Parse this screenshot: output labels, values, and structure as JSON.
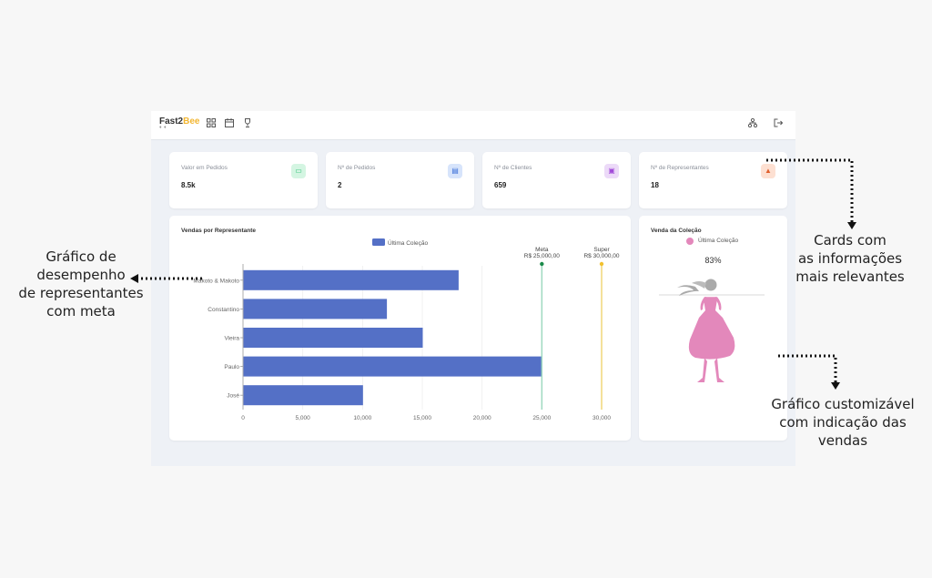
{
  "app": {
    "logo_main": "Fast2",
    "logo_accent": "Bee",
    "logo_tag": "♦ ♦"
  },
  "nav_icons": [
    "dashboard-icon",
    "calendar-icon",
    "trophy-icon"
  ],
  "header_right_icons": [
    "sitemap-icon",
    "logout-icon"
  ],
  "stats": [
    {
      "label": "Valor em Pedidos",
      "value": "8.5k",
      "icon": "money-icon",
      "icon_color": "#2bbf73",
      "icon_bg": "#d4f5e2",
      "glyph": "▭"
    },
    {
      "label": "Nº de Pedidos",
      "value": "2",
      "icon": "orders-icon",
      "icon_color": "#3b6fd8",
      "icon_bg": "#d7e4fb",
      "glyph": "▤"
    },
    {
      "label": "Nº de Clientes",
      "value": "659",
      "icon": "clients-icon",
      "icon_color": "#a24bd9",
      "icon_bg": "#ecdaf8",
      "glyph": "▣"
    },
    {
      "label": "Nº de Representantes",
      "value": "18",
      "icon": "bell-icon",
      "icon_color": "#e0602e",
      "icon_bg": "#fde0d2",
      "glyph": "▲"
    }
  ],
  "chart_data": {
    "type": "bar",
    "orientation": "horizontal",
    "title": "Vendas por Representante",
    "categories": [
      "Makoto & Makoto",
      "Constantino",
      "Vieira",
      "Paulo",
      "José"
    ],
    "series": [
      {
        "name": "Última Coleção",
        "values": [
          18000,
          12000,
          15000,
          25000,
          10000
        ],
        "color": "#5470c6"
      }
    ],
    "x_ticks": [
      "0",
      "5,000",
      "10,000",
      "15,000",
      "20,000",
      "25,000",
      "30,000"
    ],
    "xlim": [
      0,
      30000
    ],
    "grid": true,
    "legend": "top-center",
    "marklines": [
      {
        "name": "Meta",
        "label": "R$ 25,000,00",
        "value": 25000,
        "color": "#9fd9c0",
        "dot": "#1a8a4a"
      },
      {
        "name": "Super",
        "label": "R$ 30,000,00",
        "value": 30000,
        "color": "#f0d779",
        "dot": "#f2c12e"
      }
    ]
  },
  "collection": {
    "title": "Venda da Coleção",
    "legend": "Última Coleção",
    "legend_color": "#e388bb",
    "percent": 83,
    "percent_label": "83%",
    "fill_color": "#e388bb"
  },
  "annotations": {
    "left": [
      "Gráfico de",
      "desempenho",
      "de representantes",
      "com meta"
    ],
    "cards": [
      "Cards com",
      "as informações",
      "mais relevantes"
    ],
    "custom": [
      "Gráfico customizável",
      "com indicação das",
      "vendas"
    ]
  }
}
